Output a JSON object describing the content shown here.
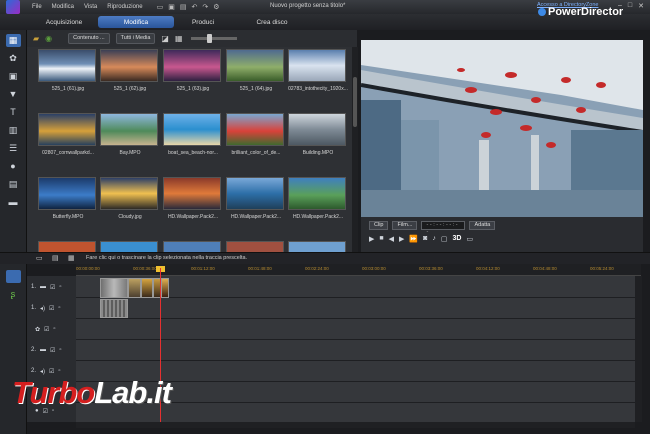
{
  "window": {
    "title": "Nuovo progetto senza titolo*",
    "menu": [
      "File",
      "Modifica",
      "Vista",
      "Riproduzione"
    ]
  },
  "tabs": [
    "Acquisizione",
    "Modifica",
    "Produci",
    "Crea disco"
  ],
  "active_tab": "Modifica",
  "header": {
    "directory_link": "Accesso a DirectoryZone",
    "brand": "PowerDirector"
  },
  "library": {
    "content_filter": "Contenuto ...",
    "media_filter": "Tutti i Media",
    "items": [
      {
        "name": "525_1 (61).jpg"
      },
      {
        "name": "525_1 (62).jpg"
      },
      {
        "name": "525_1 (63).jpg"
      },
      {
        "name": "525_1 (64).jpg"
      },
      {
        "name": "02783_intothecity_1920x..."
      },
      {
        "name": "02807_cornwallparkd..."
      },
      {
        "name": "Bay.MPO"
      },
      {
        "name": "boat_sea_beach-nor..."
      },
      {
        "name": "brilliant_color_of_de..."
      },
      {
        "name": "Building.MPO"
      },
      {
        "name": "Butterfly.MPO"
      },
      {
        "name": "Cloudy.jpg"
      },
      {
        "name": "HD.Wallpaper.Pack2..."
      },
      {
        "name": "HD.Wallpaper.Pack2..."
      },
      {
        "name": "HD.Wallpaper.Pack2..."
      }
    ]
  },
  "preview": {
    "clip_label": "Clip",
    "film_label": "Film...",
    "timecode": "- - : - - : - - : - -",
    "fit_label": "Adatta",
    "mode_3d": "3D"
  },
  "hint": "Fare clic qui o trascinare la clip selezionata nella traccia prescelta.",
  "timeline": {
    "ticks": [
      "00:00:00:00",
      "00:00:36:00",
      "00:01:12:00",
      "00:01:48:00",
      "00:02:24:00",
      "00:03:00:00",
      "00:03:36:00",
      "00:04:12:00",
      "00:04:48:00",
      "00:05:24:00"
    ],
    "tracks": [
      "1.",
      "1.",
      "",
      "2.",
      "2.",
      "",
      ""
    ]
  },
  "watermark": {
    "part1": "Turbo",
    "part2": "Lab.it"
  }
}
